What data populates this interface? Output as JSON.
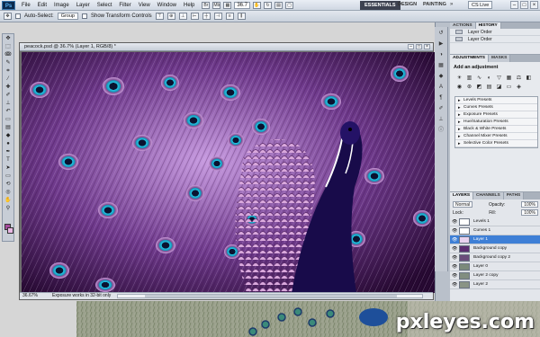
{
  "menubar": {
    "logo": "Ps",
    "items": [
      "File",
      "Edit",
      "Image",
      "Layer",
      "Select",
      "Filter",
      "View",
      "Window",
      "Help"
    ],
    "zoom_level": "36.7",
    "workspaces": {
      "active": "ESSENTIALS",
      "design": "DESIGN",
      "painting": "PAINTING",
      "more": "»"
    },
    "cs_live": "CS Live"
  },
  "optionsbar": {
    "auto_select_label": "Auto-Select:",
    "auto_select_value": "Group",
    "transform_label": "Show Transform Controls"
  },
  "document": {
    "title": "peacock.psd @ 36.7% (Layer 1, RGB/8) *",
    "zoom": "36.67%",
    "status": "Exposure works in 32-bit only"
  },
  "panels": {
    "top_tabs": [
      "ACTIONS",
      "HISTORY"
    ],
    "history_items": [
      "Layer Order",
      "Layer Order"
    ],
    "adjust_tabs": [
      "ADJUSTMENTS",
      "MASKS"
    ],
    "adjust_title": "Add an adjustment",
    "presets": [
      "Levels Presets",
      "Curves Presets",
      "Exposure Presets",
      "Hue/Saturation Presets",
      "Black & White Presets",
      "Channel Mixer Presets",
      "Selective Color Presets"
    ],
    "layers_tabs": [
      "LAYERS",
      "CHANNELS",
      "PATHS"
    ],
    "blend_mode": "Normal",
    "opacity_label": "Opacity:",
    "opacity_value": "100%",
    "lock_label": "Lock:",
    "fill_label": "Fill:",
    "fill_value": "100%",
    "layers": [
      "Levels 1",
      "Curves 1",
      "Layer 1",
      "Background copy",
      "Background copy 2",
      "Layer 0",
      "Layer 2 copy",
      "Layer 2"
    ],
    "selected_layer_index": 2
  },
  "watermark": "pxleyes.com",
  "colors": {
    "accent": "#3e7fd6",
    "foreground": "#a54b9c",
    "background": "#e9b8e4"
  }
}
